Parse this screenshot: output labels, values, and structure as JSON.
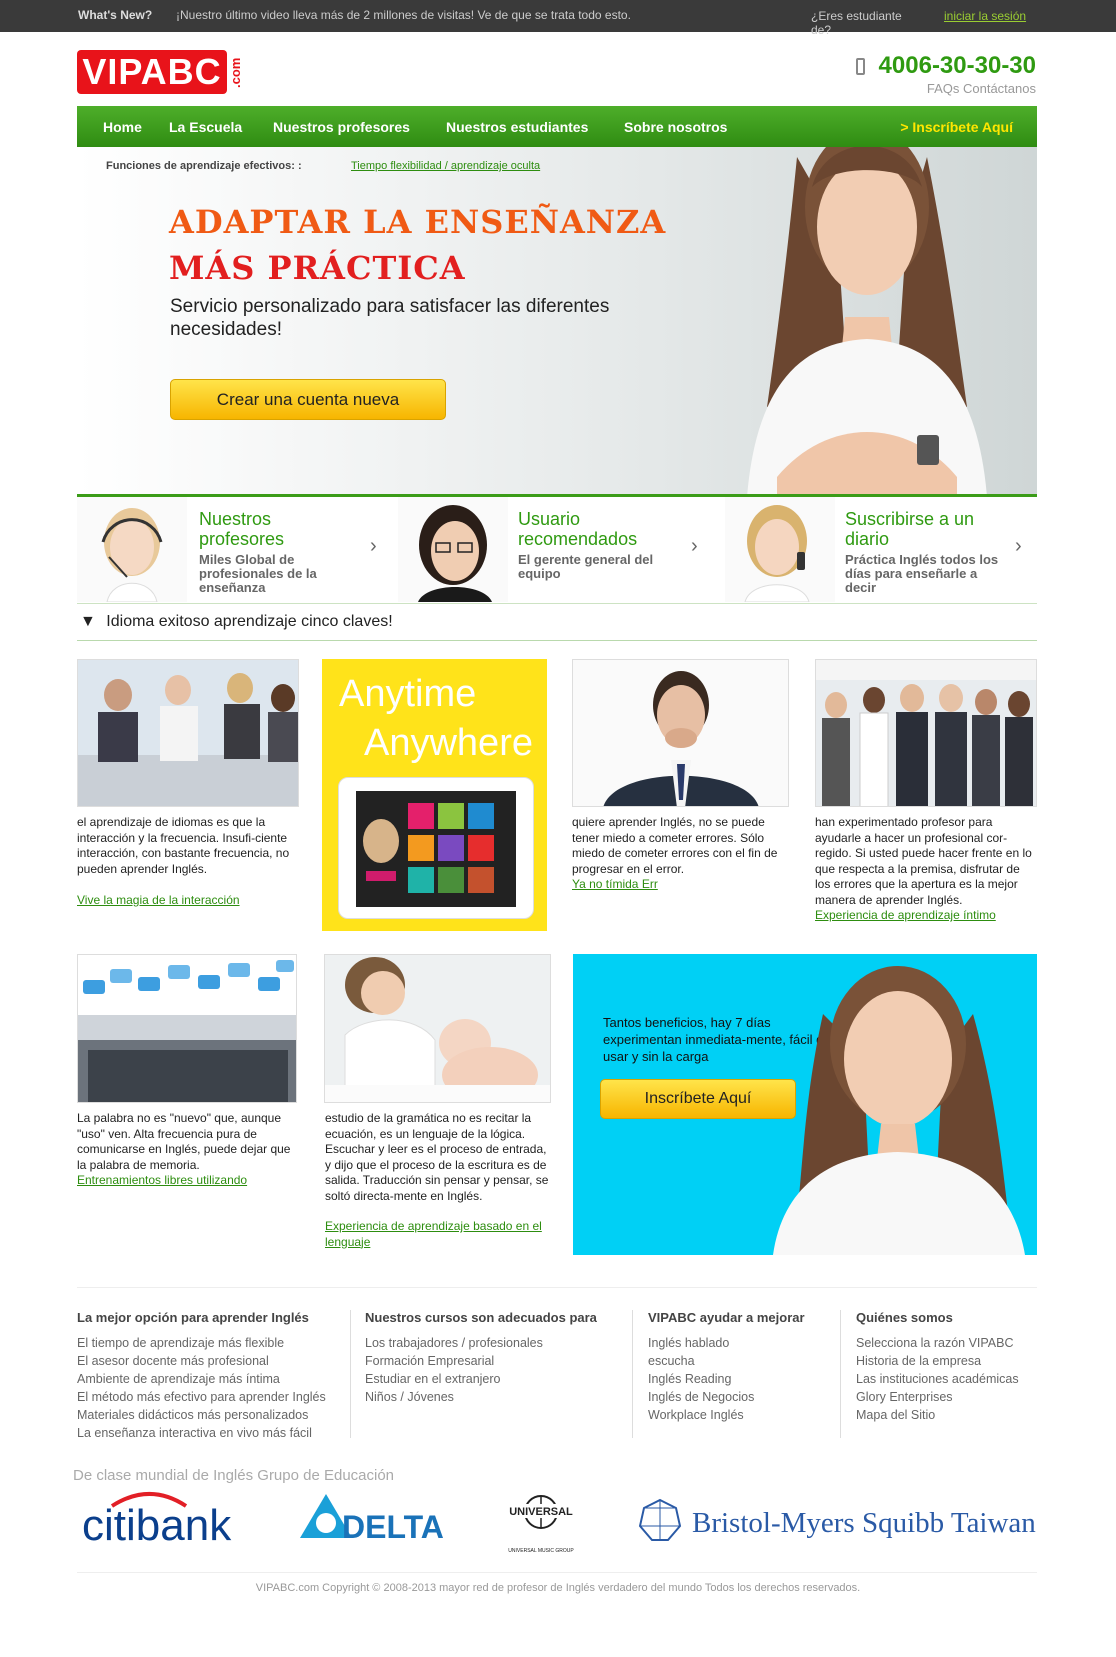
{
  "topbar": {
    "whats_new": "What's New?",
    "news": "¡Nuestro último video lleva más de 2 millones de visitas! Ve de que se trata todo esto.",
    "student_q": "¿Eres estudiante de?",
    "login": "iniciar la sesión"
  },
  "header": {
    "logo": "VIPABC",
    "logo_suffix": ".com",
    "phone": "4006-30-30-30",
    "faqs": "FAQs Contáctanos",
    "phone_icon": "mobile-phone-icon"
  },
  "nav": {
    "items": [
      "Home",
      "La Escuela",
      "Nuestros profesores",
      "Nuestros estudiantes",
      "Sobre nosotros"
    ],
    "cta": "> Inscríbete Aquí"
  },
  "hero": {
    "features_label": "Funciones de aprendizaje efectivos: :",
    "features_link": "Tiempo flexibilidad / aprendizaje oculta",
    "headline_1": "ADAPTAR LA ENSEÑANZA",
    "headline_2": "MÁS PRÁCTICA",
    "subtitle": "Servicio personalizado para satisfacer las diferentes necesidades!",
    "button": "Crear una cuenta nueva"
  },
  "promos": [
    {
      "title": "Nuestros profesores",
      "desc": "Miles Global de profesionales de la enseñanza"
    },
    {
      "title": "Usuario recomendados",
      "desc": "El gerente general del equipo"
    },
    {
      "title": "Suscribirse a un diario",
      "desc": "Práctica Inglés todos los días para enseñarle a decir"
    }
  ],
  "section": {
    "title": "Idioma exitoso aprendizaje cinco claves!",
    "icon": "triangle-down-icon"
  },
  "cards": [
    {
      "text": "el aprendizaje de idiomas es que la interacción y la frecuencia. Insufi-ciente interacción, con bastante frecuencia, no pueden aprender Inglés.",
      "link": "Vive la magia de la interacción"
    },
    {
      "t1": "Anytime",
      "t2": "Anywhere"
    },
    {
      "text": "quiere aprender Inglés, no se puede tener miedo a cometer errores. Sólo miedo de cometer errores con el fin de progresar en el error.",
      "link": "Ya no tímida Err"
    },
    {
      "text": "han experimentado profesor para ayudarle a hacer un profesional cor-regido. Si usted puede hacer frente en lo que respecta a la premisa, disfrutar de los errores que la apertura es la mejor manera de aprender Inglés.",
      "link": "Experiencia de aprendizaje íntimo"
    },
    {
      "text": "La palabra no es \"nuevo\" que, aunque \"uso\" ven. Alta frecuencia pura de comunicarse en Inglés, puede dejar que la palabra de memoria.",
      "link": "Entrenamientos libres utilizando"
    },
    {
      "text": "estudio de la gramática no es recitar la ecuación, es un lenguaje de la lógica. Escuchar y leer es el proceso de entrada, y dijo que el proceso de la escritura es de salida. Traducción sin pensar y pensar, se soltó directa-mente en Inglés.",
      "link": "Experiencia de aprendizaje basado en el lenguaje"
    }
  ],
  "blue_card": {
    "text": "Tantos beneficios, hay 7 días experimentan inmediata-mente, fácil de usar y sin la carga",
    "button": "Inscríbete Aquí"
  },
  "footer": {
    "columns": [
      {
        "title": "La mejor opción para aprender Inglés",
        "items": [
          "El tiempo de aprendizaje más flexible",
          "El asesor docente más profesional",
          "Ambiente de aprendizaje más íntima",
          "El método más efectivo para aprender Inglés",
          "Materiales didácticos más personalizados",
          "La enseñanza interactiva en vivo más fácil"
        ]
      },
      {
        "title": "Nuestros cursos son adecuados para",
        "items": [
          "Los trabajadores / profesionales",
          "Formación Empresarial",
          "Estudiar en el extranjero",
          "Niños / Jóvenes"
        ]
      },
      {
        "title": "VIPABC ayudar a mejorar",
        "items": [
          "Inglés hablado",
          "escucha",
          "Inglés Reading",
          "Inglés de Negocios",
          "Workplace Inglés"
        ]
      },
      {
        "title": "Quiénes somos",
        "items": [
          "Selecciona la razón VIPABC",
          "Historia de la empresa",
          "Las instituciones académicas",
          "Glory Enterprises",
          "Mapa del Sitio"
        ]
      }
    ],
    "partners_title": "De clase mundial de Inglés Grupo de Educación",
    "partners": [
      "citibank",
      "DELTA",
      "UNIVERSAL",
      "UNIVERSAL MUSIC GROUP",
      "Bristol-Myers Squibb Taiwan"
    ],
    "copyright": "VIPABC.com Copyright © 2008-2013 mayor red de profesor de Inglés verdadero del mundo Todos los derechos reservados."
  },
  "colors": {
    "brand_red": "#e8131a",
    "brand_green": "#2f9a11",
    "cta_yellow": "#ffe31a",
    "promo_blue": "#00d0f5"
  }
}
